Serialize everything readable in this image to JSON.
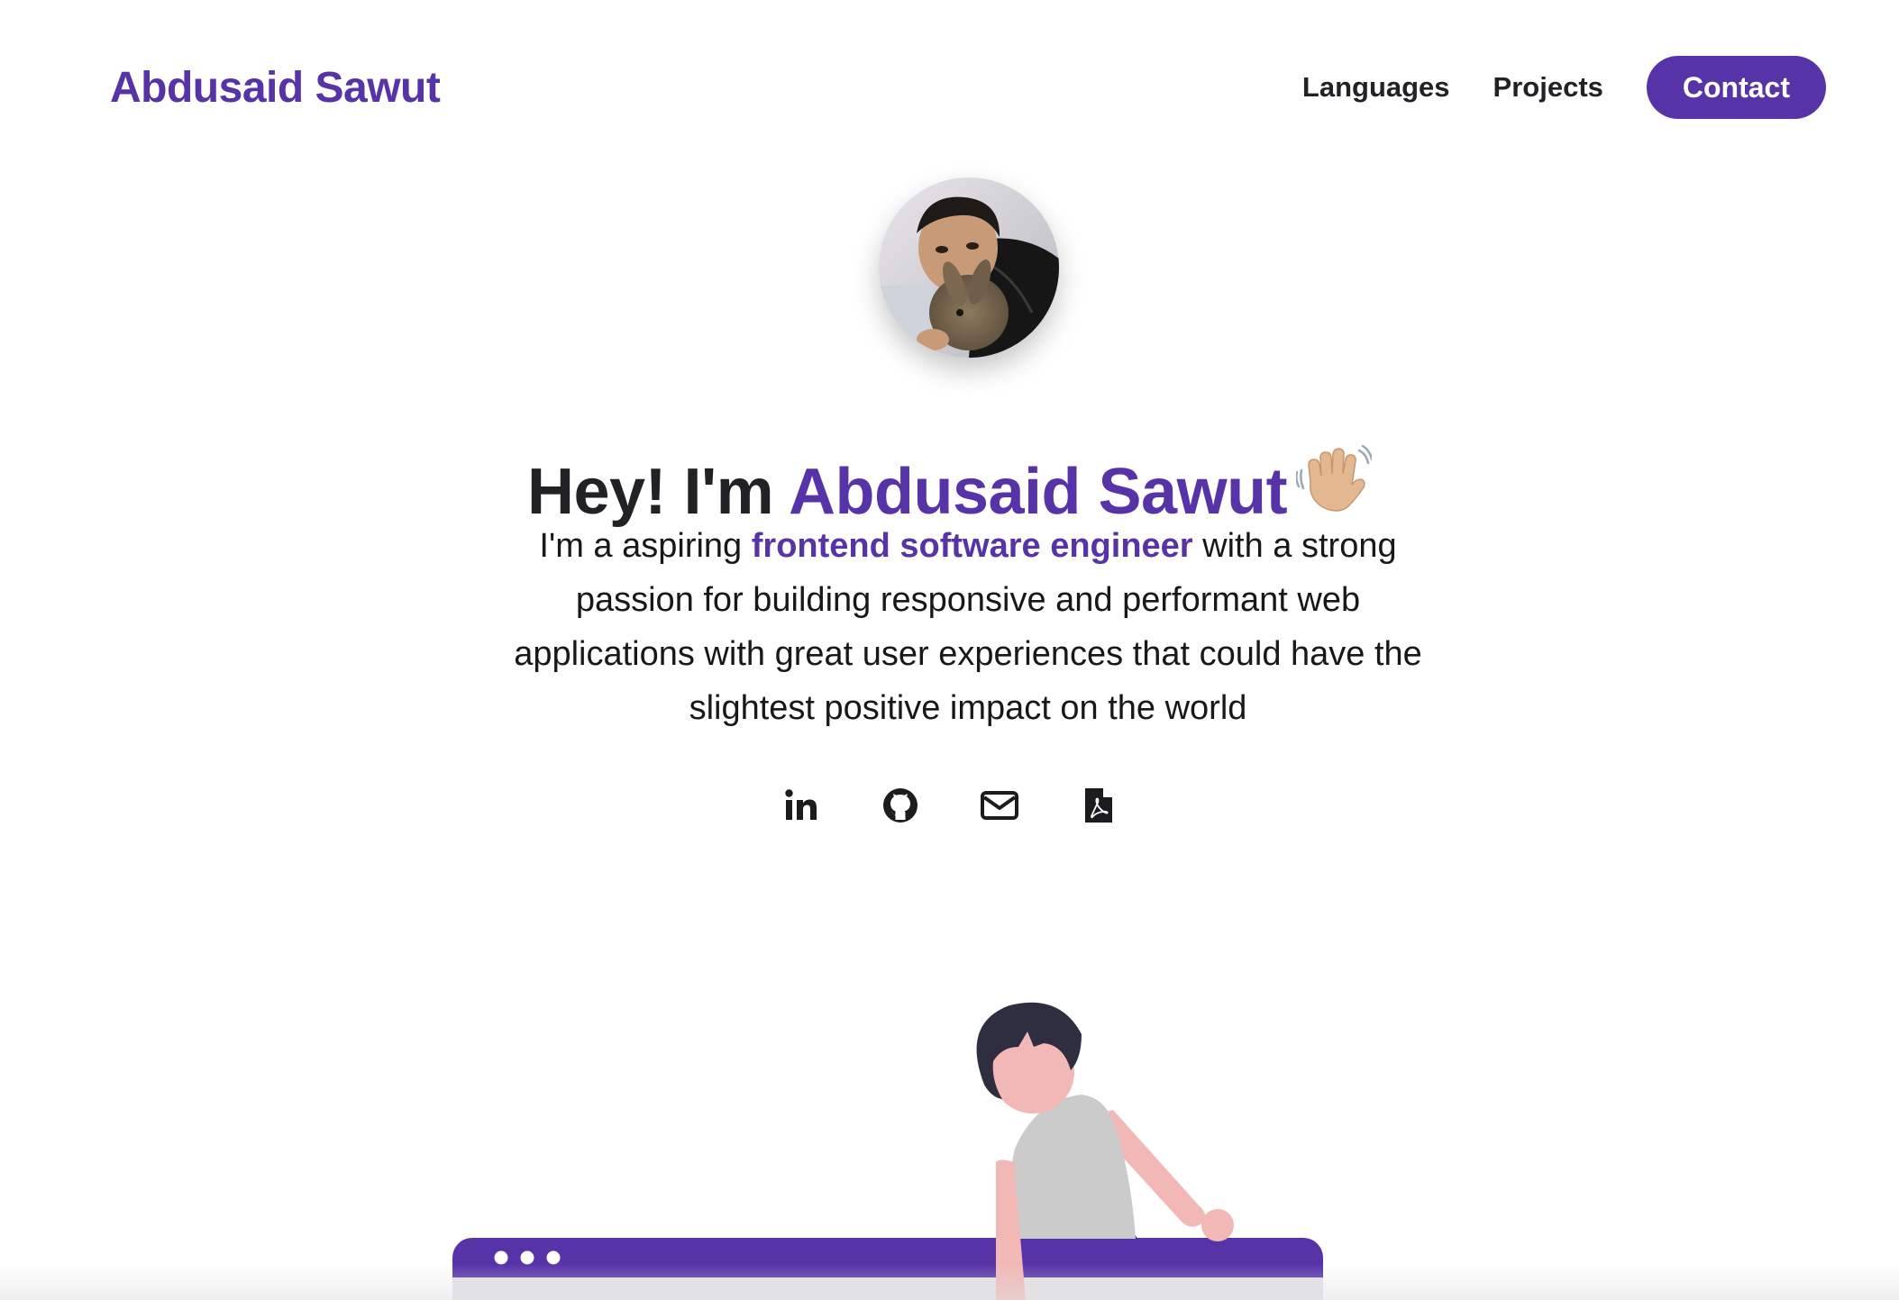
{
  "header": {
    "brand": "Abdusaid Sawut",
    "nav": {
      "languages": "Languages",
      "projects": "Projects",
      "contact": "Contact"
    }
  },
  "hero": {
    "title_prefix": "Hey! I'm ",
    "title_name": "Abdusaid Sawut",
    "bio": {
      "before": "I'm a aspiring ",
      "highlight": "frontend software engineer",
      "after": " with a strong passion for building responsive and performant web applications with great user experiences that could have the slightest positive impact on the world"
    }
  },
  "socials": [
    {
      "icon": "linkedin-icon"
    },
    {
      "icon": "github-icon"
    },
    {
      "icon": "mail-icon"
    },
    {
      "icon": "pdf-resume-icon"
    }
  ],
  "colors": {
    "accent": "#5733a8",
    "text": "#222226",
    "background": "#ffffff"
  }
}
